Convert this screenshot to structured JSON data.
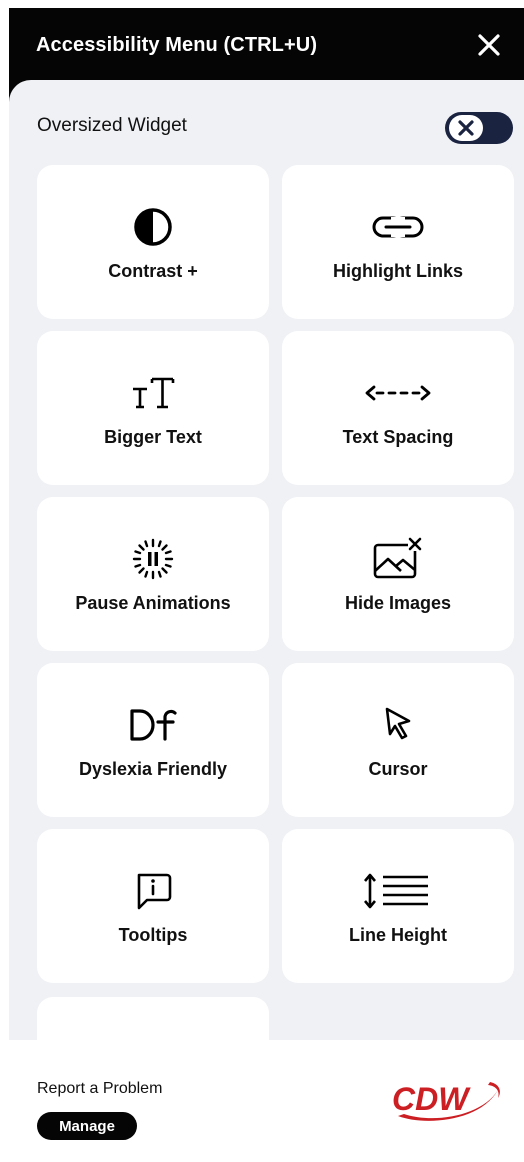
{
  "header": {
    "title": "Accessibility Menu (CTRL+U)"
  },
  "oversized": {
    "label": "Oversized Widget",
    "enabled": false
  },
  "tiles": [
    {
      "label": "Contrast +",
      "icon": "contrast-icon"
    },
    {
      "label": "Highlight Links",
      "icon": "link-icon"
    },
    {
      "label": "Bigger Text",
      "icon": "text-size-icon"
    },
    {
      "label": "Text Spacing",
      "icon": "text-spacing-icon"
    },
    {
      "label": "Pause Animations",
      "icon": "pause-animations-icon"
    },
    {
      "label": "Hide Images",
      "icon": "hide-images-icon"
    },
    {
      "label": "Dyslexia Friendly",
      "icon": "dyslexia-icon"
    },
    {
      "label": "Cursor",
      "icon": "cursor-icon"
    },
    {
      "label": "Tooltips",
      "icon": "tooltip-icon"
    },
    {
      "label": "Line Height",
      "icon": "line-height-icon"
    }
  ],
  "footer": {
    "report_label": "Report a Problem",
    "manage_label": "Manage",
    "brand": "CDW"
  },
  "colors": {
    "header_bg": "#050505",
    "panel_bg": "#f0f1f5",
    "toggle_bg": "#1a2340",
    "brand_red": "#cc1f24"
  }
}
